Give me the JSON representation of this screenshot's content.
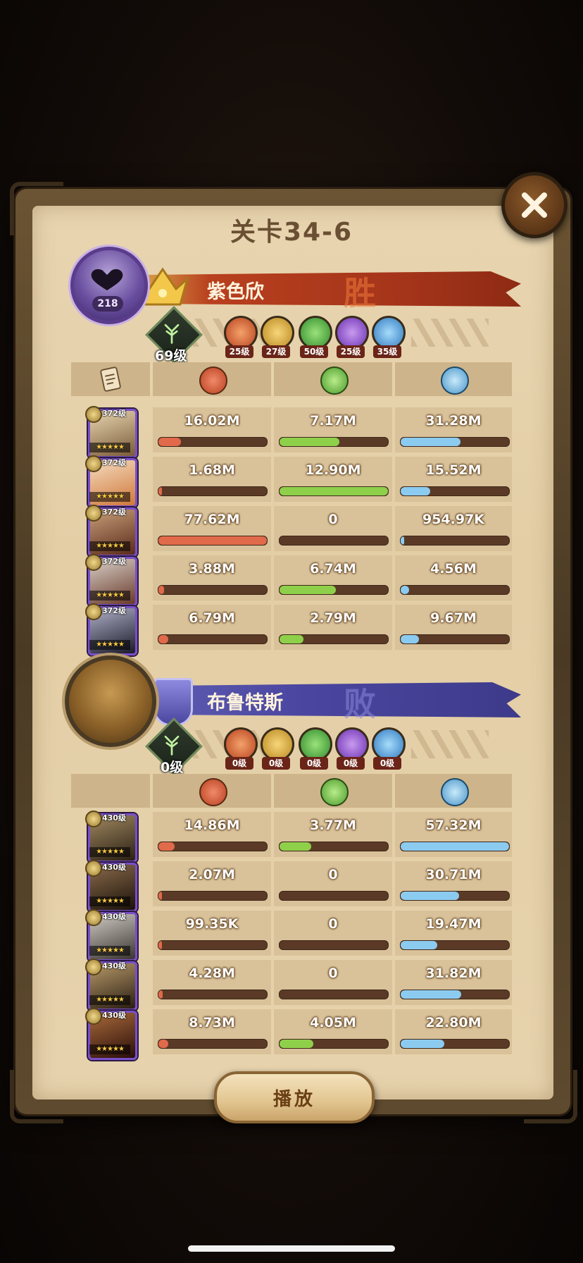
{
  "title": "关卡34-6",
  "close_icon": "close-icon",
  "play_label": "播放",
  "colors": {
    "damage": "#e06a4a",
    "heal": "#8fd04a",
    "tank": "#8ccbf0",
    "win_banner": "#a4341a",
    "lose_banner": "#4a46a0"
  },
  "stat_icons": [
    "damage-icon",
    "heal-icon",
    "damage-taken-icon"
  ],
  "teams": [
    {
      "player_name": "紫色欣",
      "player_level": "218",
      "result": "胜",
      "tree_level": "69级",
      "factions": [
        {
          "name": "lightbearer",
          "level": "25级",
          "color": "#d8643a"
        },
        {
          "name": "mauler",
          "level": "27级",
          "color": "#e0a83a"
        },
        {
          "name": "wilder",
          "level": "50级",
          "color": "#3fae3c"
        },
        {
          "name": "graveborn",
          "level": "25级",
          "color": "#8a3fd0"
        },
        {
          "name": "celestial",
          "level": "35级",
          "color": "#4aa6e6"
        }
      ],
      "heroes": [
        {
          "level": "372级",
          "stars": "★★★★★",
          "damage": "16.02M",
          "heal": "7.17M",
          "tank": "31.28M",
          "damage_pct": 0.21,
          "heal_pct": 0.55,
          "tank_pct": 0.55
        },
        {
          "level": "372级",
          "stars": "★★★★★",
          "damage": "1.68M",
          "heal": "12.90M",
          "tank": "15.52M",
          "damage_pct": 0.03,
          "heal_pct": 1.0,
          "tank_pct": 0.27
        },
        {
          "level": "372级",
          "stars": "★★★★★",
          "damage": "77.62M",
          "heal": "0",
          "tank": "954.97K",
          "damage_pct": 1.0,
          "heal_pct": 0.0,
          "tank_pct": 0.02
        },
        {
          "level": "372级",
          "stars": "★★★★★",
          "damage": "3.88M",
          "heal": "6.74M",
          "tank": "4.56M",
          "damage_pct": 0.05,
          "heal_pct": 0.52,
          "tank_pct": 0.08
        },
        {
          "level": "372级",
          "stars": "★★★★★",
          "damage": "6.79M",
          "heal": "2.79M",
          "tank": "9.67M",
          "damage_pct": 0.09,
          "heal_pct": 0.22,
          "tank_pct": 0.17
        }
      ]
    },
    {
      "player_name": "布鲁特斯",
      "player_level": "",
      "result": "败",
      "tree_level": "0级",
      "factions": [
        {
          "name": "lightbearer",
          "level": "0级",
          "color": "#d8643a"
        },
        {
          "name": "mauler",
          "level": "0级",
          "color": "#e0a83a"
        },
        {
          "name": "wilder",
          "level": "0级",
          "color": "#3fae3c"
        },
        {
          "name": "graveborn",
          "level": "0级",
          "color": "#8a3fd0"
        },
        {
          "name": "celestial",
          "level": "0级",
          "color": "#4aa6e6"
        }
      ],
      "heroes": [
        {
          "level": "430级",
          "stars": "★★★★★",
          "damage": "14.86M",
          "heal": "3.77M",
          "tank": "57.32M",
          "damage_pct": 0.15,
          "heal_pct": 0.29,
          "tank_pct": 1.0
        },
        {
          "level": "430级",
          "stars": "★★★★★",
          "damage": "2.07M",
          "heal": "0",
          "tank": "30.71M",
          "damage_pct": 0.02,
          "heal_pct": 0.0,
          "tank_pct": 0.54
        },
        {
          "level": "430级",
          "stars": "★★★★★",
          "damage": "99.35K",
          "heal": "0",
          "tank": "19.47M",
          "damage_pct": 0.005,
          "heal_pct": 0.0,
          "tank_pct": 0.34
        },
        {
          "level": "430级",
          "stars": "★★★★★",
          "damage": "4.28M",
          "heal": "0",
          "tank": "31.82M",
          "damage_pct": 0.04,
          "heal_pct": 0.0,
          "tank_pct": 0.56
        },
        {
          "level": "430级",
          "stars": "★★★★★",
          "damage": "8.73M",
          "heal": "4.05M",
          "tank": "22.80M",
          "damage_pct": 0.09,
          "heal_pct": 0.31,
          "tank_pct": 0.4
        }
      ]
    }
  ]
}
